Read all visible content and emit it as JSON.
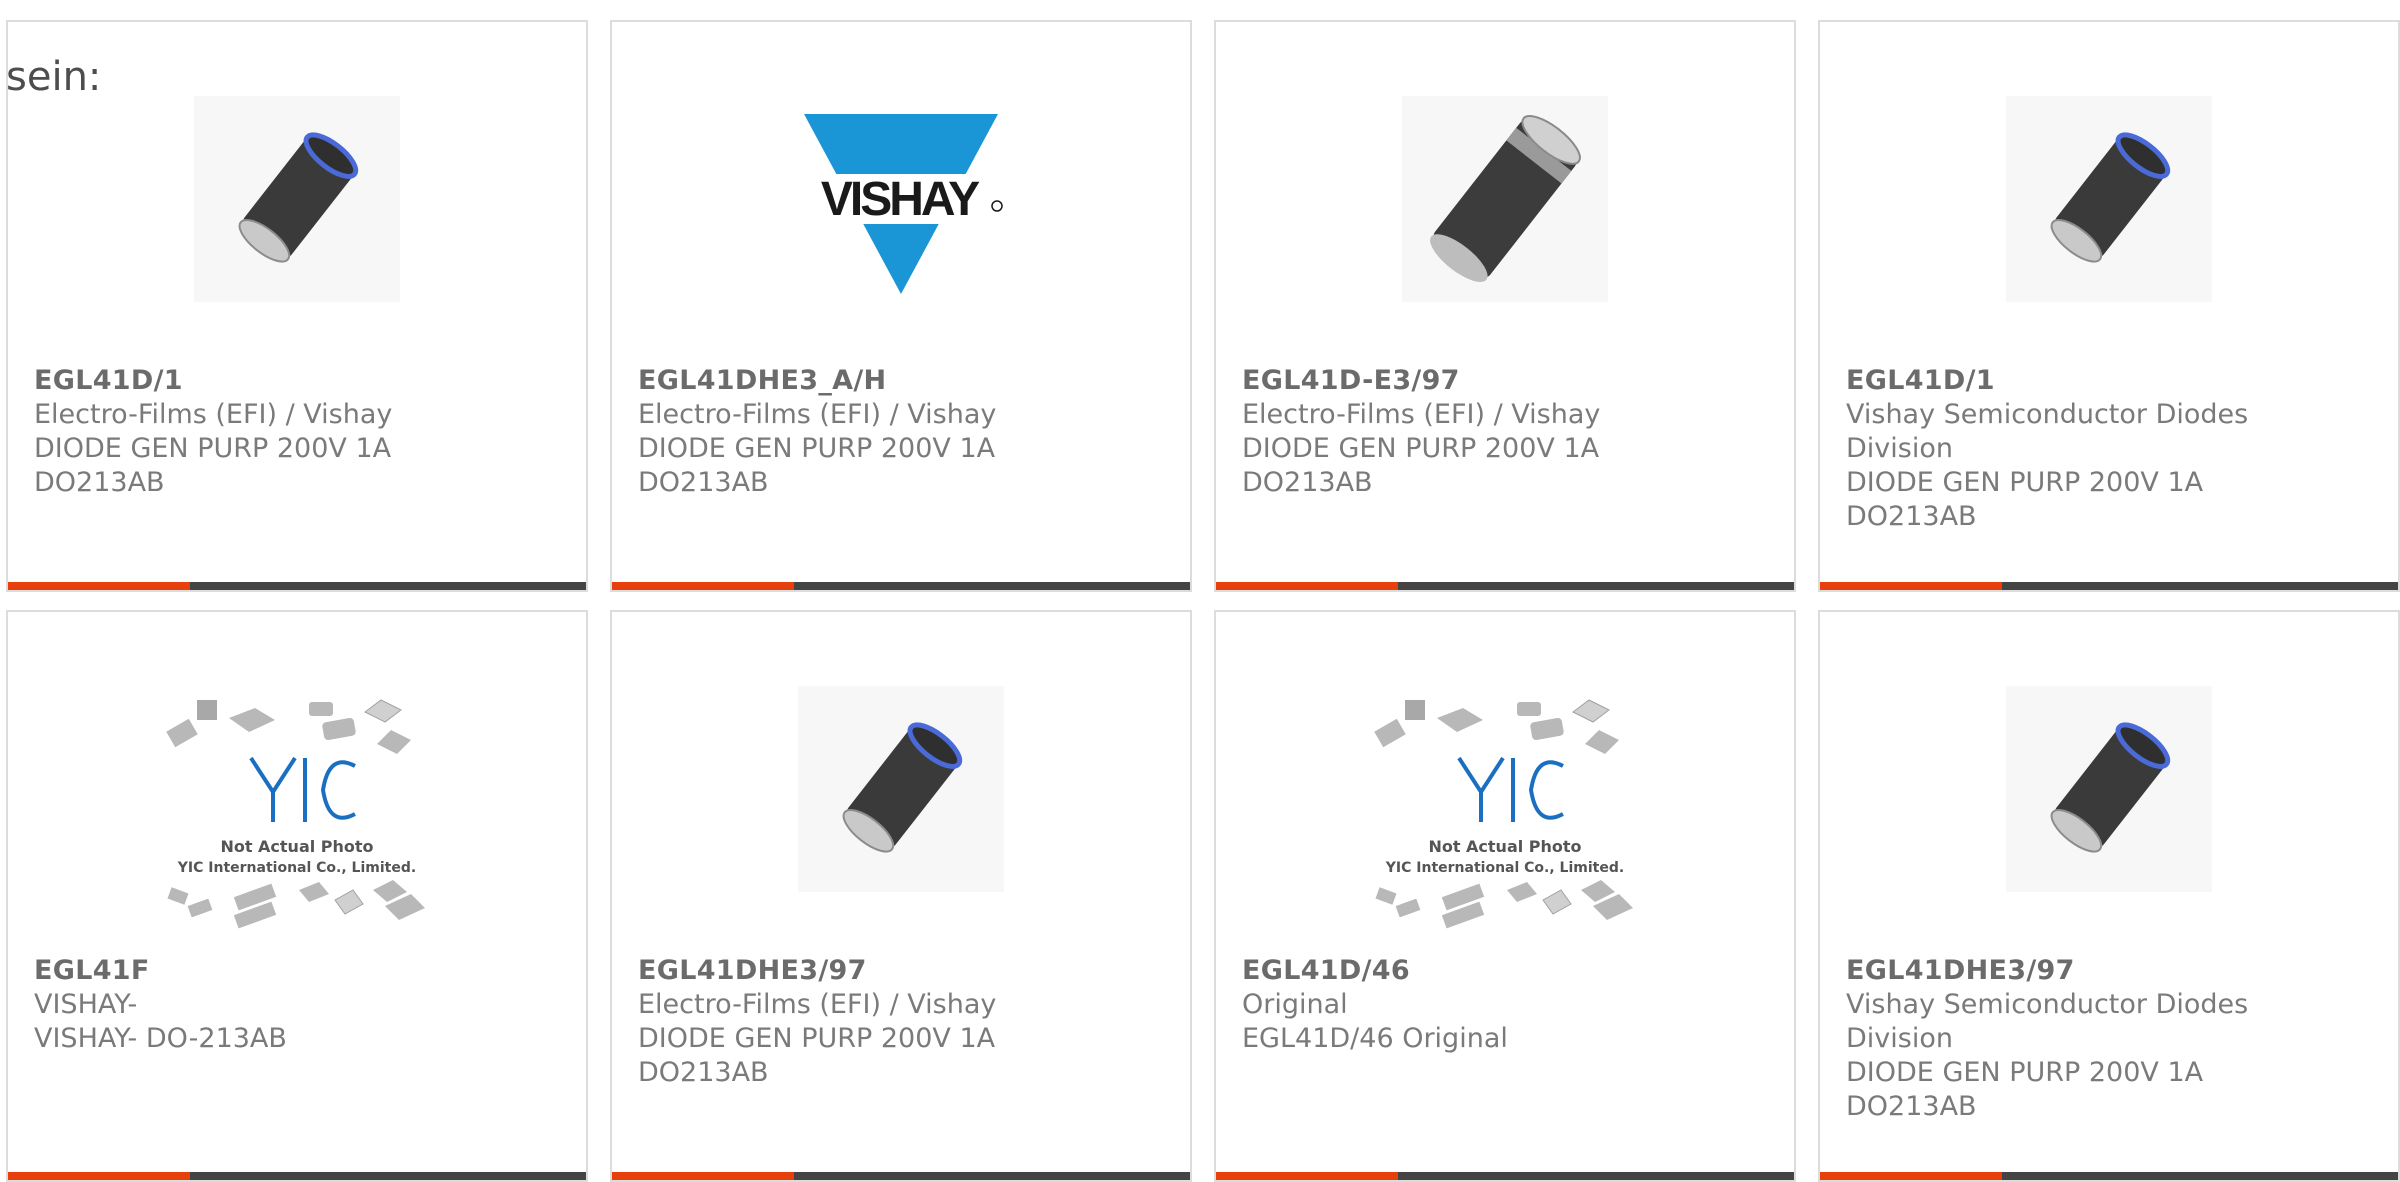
{
  "lead_text": "sein:",
  "accent_color": "#e8400c",
  "cards": [
    {
      "image": "diode-cylinder-blue-band",
      "part": "EGL41D/1",
      "maker": "Electro-Films (EFI) / Vishay",
      "desc": "DIODE GEN PURP 200V 1A",
      "package": "DO213AB"
    },
    {
      "image": "vishay-logo",
      "logo_text": "VISHAY",
      "part": "EGL41DHE3_A/H",
      "maker": "Electro-Films (EFI) / Vishay",
      "desc": "DIODE GEN PURP 200V 1A",
      "package": "DO213AB"
    },
    {
      "image": "diode-cylinder-grey-band",
      "part": "EGL41D-E3/97",
      "maker": "Electro-Films (EFI) / Vishay",
      "desc": "DIODE GEN PURP 200V 1A",
      "package": "DO213AB"
    },
    {
      "image": "diode-cylinder-blue-band",
      "part": "EGL41D/1",
      "maker_line1": "Vishay Semiconductor Diodes",
      "maker_line2": "Division",
      "desc": "DIODE GEN PURP 200V 1A",
      "package": "DO213AB"
    },
    {
      "image": "yic-placeholder",
      "logo_text": "YIC",
      "placeholder_line1": "Not Actual Photo",
      "placeholder_line2": "YIC International Co., Limited.",
      "part": "EGL41F",
      "maker": "VISHAY-",
      "desc": "VISHAY- DO-213AB"
    },
    {
      "image": "diode-cylinder-blue-band",
      "part": "EGL41DHE3/97",
      "maker": "Electro-Films (EFI) / Vishay",
      "desc": "DIODE GEN PURP 200V 1A",
      "package": "DO213AB"
    },
    {
      "image": "yic-placeholder",
      "logo_text": "YIC",
      "placeholder_line1": "Not Actual Photo",
      "placeholder_line2": "YIC International Co., Limited.",
      "part": "EGL41D/46",
      "maker": "Original",
      "desc": "EGL41D/46 Original"
    },
    {
      "image": "diode-cylinder-blue-band",
      "part": "EGL41DHE3/97",
      "maker_line1": "Vishay Semiconductor Diodes",
      "maker_line2": "Division",
      "desc": "DIODE GEN PURP 200V 1A",
      "package": "DO213AB"
    }
  ]
}
